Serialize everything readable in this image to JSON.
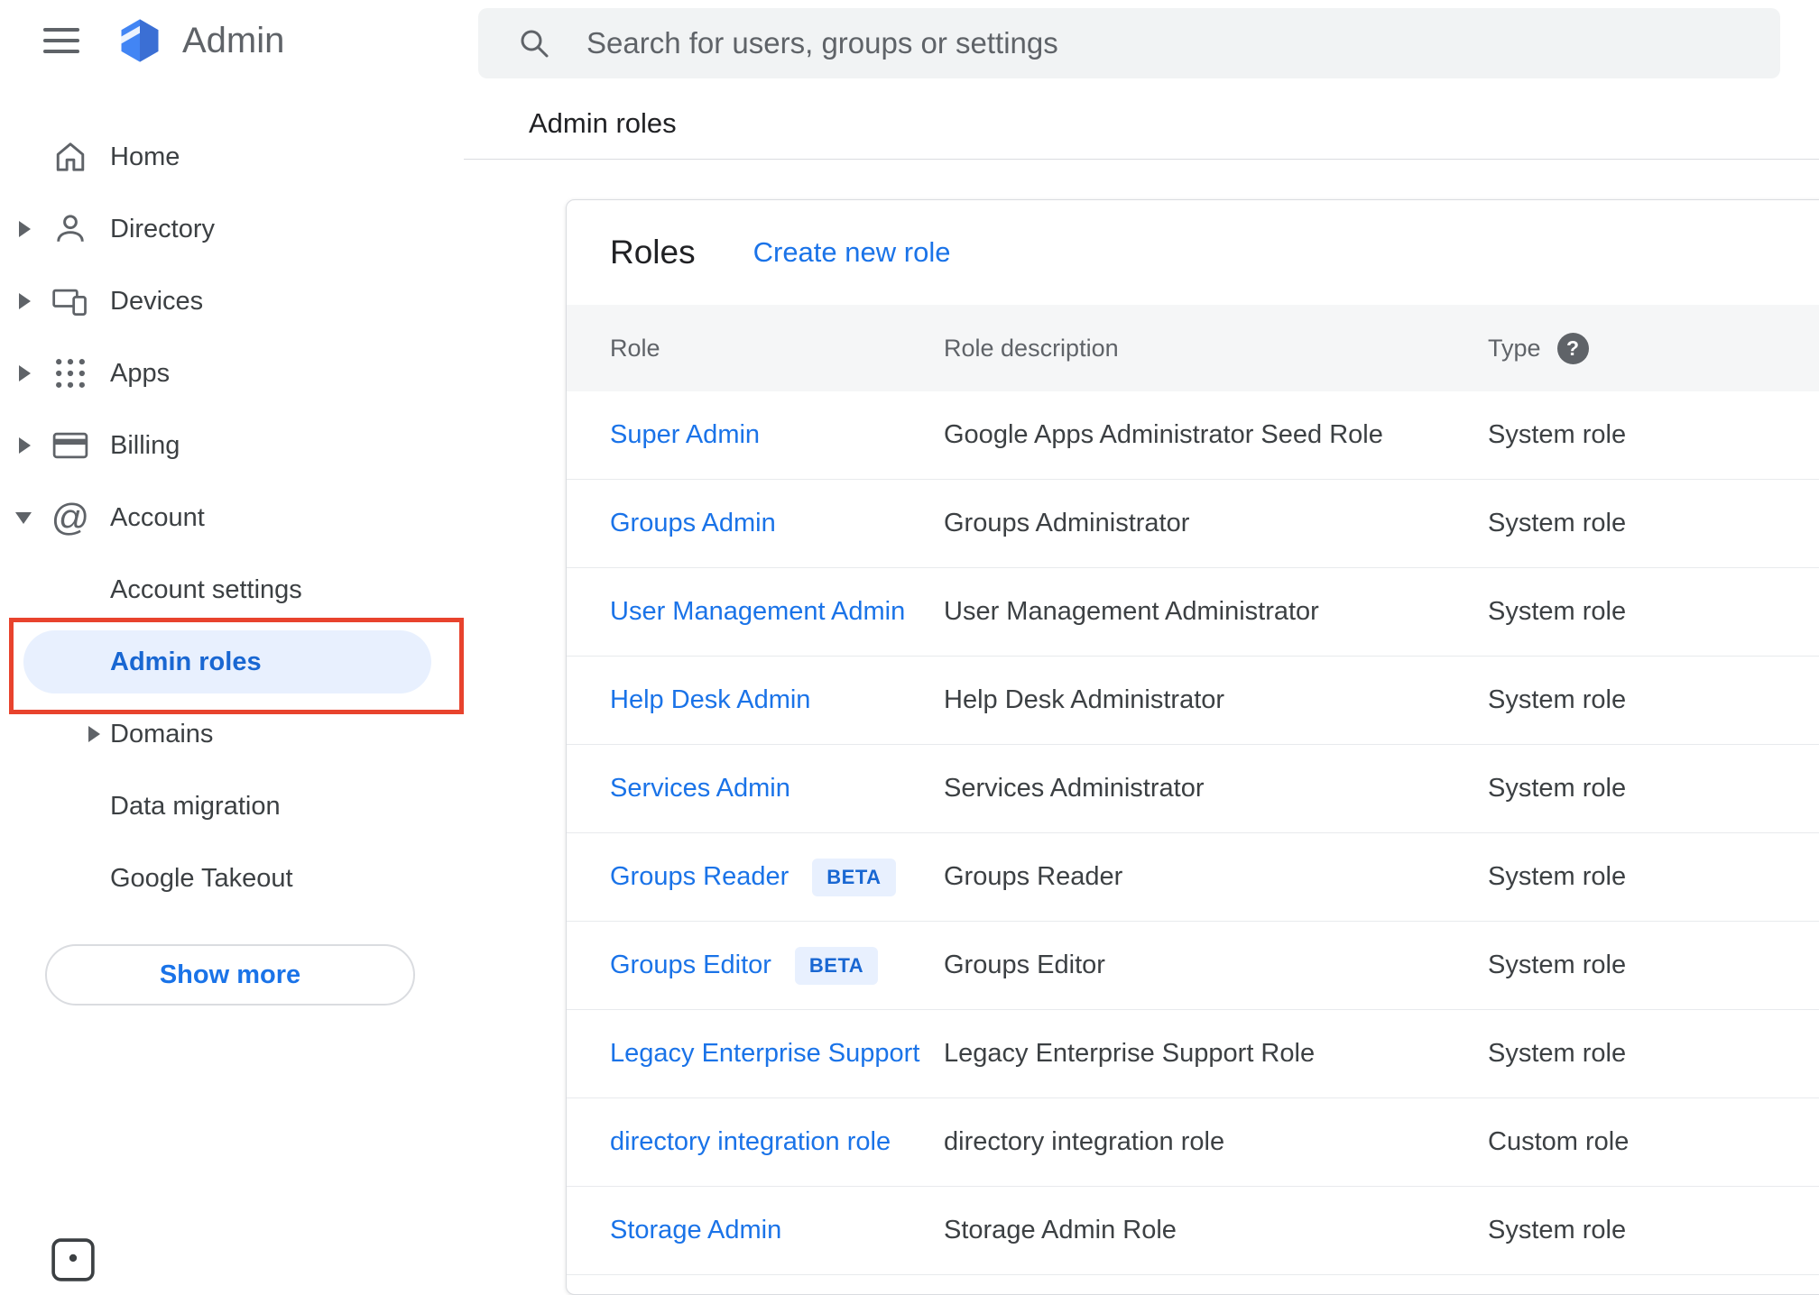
{
  "app": {
    "title": "Admin"
  },
  "search": {
    "placeholder": "Search for users, groups or settings"
  },
  "breadcrumb": {
    "label": "Admin roles"
  },
  "sidebar": {
    "items": [
      {
        "label": "Home",
        "icon": "home-icon",
        "expandable": false
      },
      {
        "label": "Directory",
        "icon": "directory-icon",
        "expandable": true
      },
      {
        "label": "Devices",
        "icon": "devices-icon",
        "expandable": true
      },
      {
        "label": "Apps",
        "icon": "apps-icon",
        "expandable": true
      },
      {
        "label": "Billing",
        "icon": "billing-icon",
        "expandable": true
      },
      {
        "label": "Account",
        "icon": "account-icon",
        "expanded": true
      }
    ],
    "account_children": [
      {
        "label": "Account settings",
        "selected": false
      },
      {
        "label": "Admin roles",
        "selected": true,
        "annotated": true
      },
      {
        "label": "Domains",
        "expandable": true
      },
      {
        "label": "Data migration",
        "selected": false
      },
      {
        "label": "Google Takeout",
        "selected": false
      }
    ],
    "show_more_label": "Show more"
  },
  "roles_panel": {
    "title": "Roles",
    "create_link_label": "Create new role",
    "columns": {
      "role": "Role",
      "description": "Role description",
      "type": "Type"
    },
    "beta_label": "BETA",
    "help_icon_glyph": "?",
    "rows": [
      {
        "role": "Super Admin",
        "beta": false,
        "description": "Google Apps Administrator Seed Role",
        "type": "System role"
      },
      {
        "role": "Groups Admin",
        "beta": false,
        "description": "Groups Administrator",
        "type": "System role"
      },
      {
        "role": "User Management Admin",
        "beta": false,
        "description": "User Management Administrator",
        "type": "System role"
      },
      {
        "role": "Help Desk Admin",
        "beta": false,
        "description": "Help Desk Administrator",
        "type": "System role"
      },
      {
        "role": "Services Admin",
        "beta": false,
        "description": "Services Administrator",
        "type": "System role"
      },
      {
        "role": "Groups Reader",
        "beta": true,
        "description": "Groups Reader",
        "type": "System role"
      },
      {
        "role": "Groups Editor",
        "beta": true,
        "description": "Groups Editor",
        "type": "System role"
      },
      {
        "role": "Legacy Enterprise Support",
        "beta": false,
        "description": "Legacy Enterprise Support Role",
        "type": "System role"
      },
      {
        "role": "directory integration role",
        "beta": false,
        "description": "directory integration role",
        "type": "Custom role"
      },
      {
        "role": "Storage Admin",
        "beta": false,
        "description": "Storage Admin Role",
        "type": "System role"
      }
    ]
  },
  "colors": {
    "link_blue": "#1a73e8",
    "selected_text_blue": "#1967d2",
    "selected_bg_blue": "#e8f0fe",
    "annotation_red": "#e8432d",
    "table_header_bg": "#f5f6f7",
    "search_bg": "#f1f3f4",
    "text_gray": "#5f6368",
    "text_dark": "#202124",
    "logo_blue": "#4285f4"
  }
}
